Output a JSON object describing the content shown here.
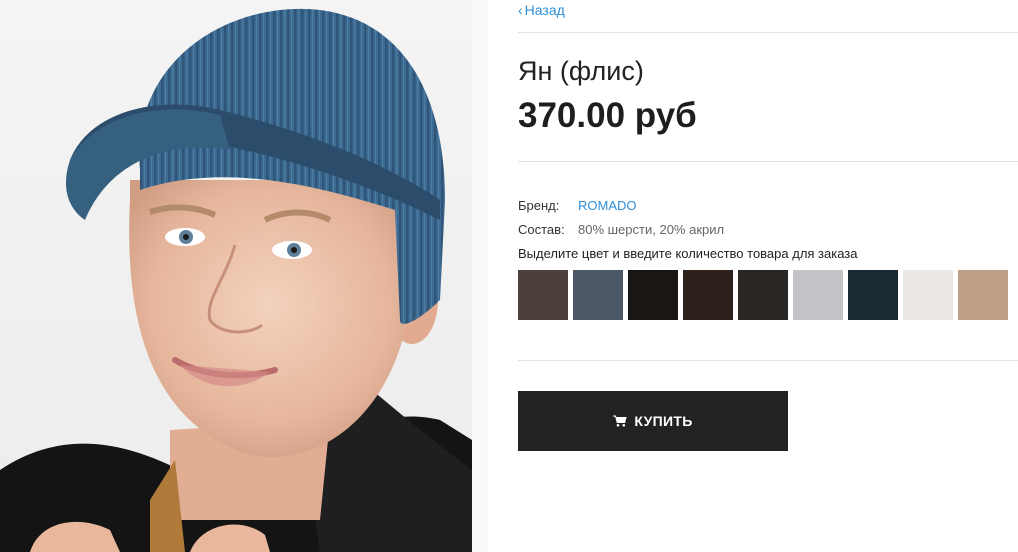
{
  "nav": {
    "back_label": "Назад",
    "back_icon": "chevron-left-icon"
  },
  "product": {
    "title": "Ян (флис)",
    "price": "370.00 руб",
    "brand_label": "Бренд:",
    "brand_value": "ROMADO",
    "composition_label": "Состав:",
    "composition_value": "80% шерсти, 20% акрил"
  },
  "color_select": {
    "instruction": "Выделите цвет и введите количество товара для заказа",
    "swatches": [
      {
        "name": "brown-grey",
        "color": "#4a3f3a"
      },
      {
        "name": "slate-blue",
        "color": "#4d5866"
      },
      {
        "name": "black",
        "color": "#1a1614"
      },
      {
        "name": "dark-brown",
        "color": "#2d1f1a"
      },
      {
        "name": "charcoal",
        "color": "#2a2623"
      },
      {
        "name": "light-grey",
        "color": "#c2c3c6"
      },
      {
        "name": "dark-teal",
        "color": "#1a2a33"
      },
      {
        "name": "off-white",
        "color": "#ece8e4"
      },
      {
        "name": "beige",
        "color": "#bf9f87"
      }
    ]
  },
  "buy_button": {
    "label": "КУПИТЬ",
    "icon": "cart-icon"
  },
  "image": {
    "subject": "product-photo",
    "accent": "#3d6a91"
  }
}
